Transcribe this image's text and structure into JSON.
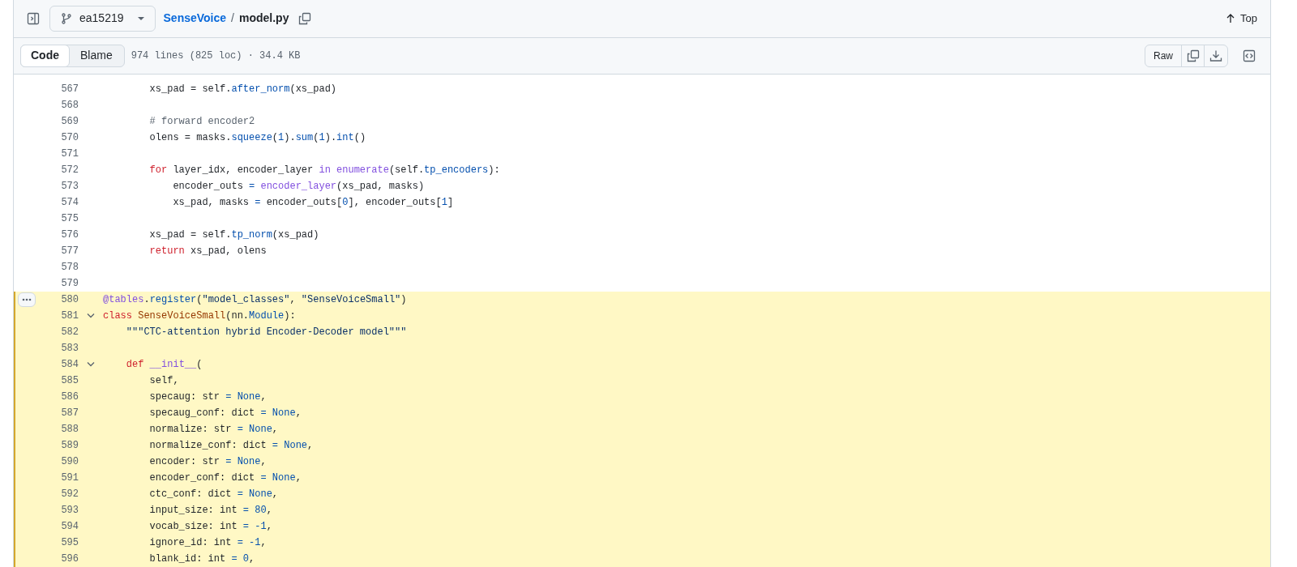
{
  "header": {
    "branch": "ea15219",
    "breadcrumb": {
      "repo": "SenseVoice",
      "separator": "/",
      "file": "model.py"
    },
    "top_label": "Top"
  },
  "toolbar": {
    "tabs": [
      {
        "label": "Code",
        "selected": true
      },
      {
        "label": "Blame",
        "selected": false
      }
    ],
    "file_info": "974 lines (825 loc) · 34.4 KB",
    "raw_label": "Raw"
  },
  "code_lines": [
    {
      "number": "567",
      "highlighted": false,
      "fold": false,
      "line_menu": false,
      "tokens": [
        {
          "text": "        xs_pad = self.",
          "kind": "plain"
        },
        {
          "text": "after_norm",
          "kind": "attr"
        },
        {
          "text": "(xs_pad)",
          "kind": "plain"
        }
      ]
    },
    {
      "number": "568",
      "highlighted": false,
      "fold": false,
      "line_menu": false
    },
    {
      "number": "569",
      "highlighted": false,
      "fold": false,
      "line_menu": false,
      "tokens": [
        {
          "text": "        # forward encoder2",
          "kind": "comment"
        }
      ]
    },
    {
      "number": "570",
      "highlighted": false,
      "fold": false,
      "line_menu": false,
      "tokens": [
        {
          "text": "        olens = masks.",
          "kind": "plain"
        },
        {
          "text": "squeeze",
          "kind": "attr"
        },
        {
          "text": "(",
          "kind": "plain"
        },
        {
          "text": "1",
          "kind": "attr"
        },
        {
          "text": ").",
          "kind": "plain"
        },
        {
          "text": "sum",
          "kind": "attr"
        },
        {
          "text": "(",
          "kind": "plain"
        },
        {
          "text": "1",
          "kind": "attr"
        },
        {
          "text": ").",
          "kind": "plain"
        },
        {
          "text": "int",
          "kind": "attr"
        },
        {
          "text": "()",
          "kind": "plain"
        }
      ]
    },
    {
      "number": "571",
      "highlighted": false,
      "fold": false,
      "line_menu": false
    },
    {
      "number": "572",
      "highlighted": false,
      "fold": false,
      "line_menu": false,
      "tokens": [
        {
          "text": "        for",
          "kind": "keyword"
        },
        {
          "text": " layer_idx, encoder_layer ",
          "kind": "plain"
        },
        {
          "text": "in enumerate",
          "kind": "call"
        },
        {
          "text": "(self.",
          "kind": "plain"
        },
        {
          "text": "tp_encoders",
          "kind": "attr"
        },
        {
          "text": "):",
          "kind": "plain"
        }
      ]
    },
    {
      "number": "573",
      "highlighted": false,
      "fold": false,
      "line_menu": false,
      "tokens": [
        {
          "text": "            encoder_outs ",
          "kind": "plain"
        },
        {
          "text": "=",
          "kind": "attr"
        },
        {
          "text": " encoder_layer",
          "kind": "call"
        },
        {
          "text": "(xs_pad, masks)",
          "kind": "plain"
        }
      ]
    },
    {
      "number": "574",
      "highlighted": false,
      "fold": false,
      "line_menu": false,
      "tokens": [
        {
          "text": "            xs_pad, masks ",
          "kind": "plain"
        },
        {
          "text": "=",
          "kind": "attr"
        },
        {
          "text": " encoder_outs[",
          "kind": "plain"
        },
        {
          "text": "0",
          "kind": "attr"
        },
        {
          "text": "], encoder_outs[",
          "kind": "plain"
        },
        {
          "text": "1",
          "kind": "attr"
        },
        {
          "text": "]",
          "kind": "plain"
        }
      ]
    },
    {
      "number": "575",
      "highlighted": false,
      "fold": false,
      "line_menu": false
    },
    {
      "number": "576",
      "highlighted": false,
      "fold": false,
      "line_menu": false,
      "tokens": [
        {
          "text": "        xs_pad = self.",
          "kind": "plain"
        },
        {
          "text": "tp_norm",
          "kind": "attr"
        },
        {
          "text": "(xs_pad)",
          "kind": "plain"
        }
      ]
    },
    {
      "number": "577",
      "highlighted": false,
      "fold": false,
      "line_menu": false,
      "tokens": [
        {
          "text": "        return",
          "kind": "keyword"
        },
        {
          "text": " xs_pad, olens",
          "kind": "plain"
        }
      ]
    },
    {
      "number": "578",
      "highlighted": false,
      "fold": false,
      "line_menu": false
    },
    {
      "number": "579",
      "highlighted": false,
      "fold": false,
      "line_menu": false
    },
    {
      "number": "580",
      "highlighted": true,
      "fold": false,
      "line_menu": true,
      "tokens": [
        {
          "text": "@tables",
          "kind": "call"
        },
        {
          "text": ".",
          "kind": "plain"
        },
        {
          "text": "register",
          "kind": "attr"
        },
        {
          "text": "(",
          "kind": "plain"
        },
        {
          "text": "\"model_classes\"",
          "kind": "string"
        },
        {
          "text": ",",
          "kind": "plain"
        },
        {
          "text": " \"SenseVoiceSmall\"",
          "kind": "string"
        },
        {
          "text": ")",
          "kind": "plain"
        }
      ]
    },
    {
      "number": "581",
      "highlighted": true,
      "fold": true,
      "line_menu": false,
      "tokens": [
        {
          "text": "class",
          "kind": "keyword"
        },
        {
          "text": " SenseVoiceSmall",
          "kind": "class"
        },
        {
          "text": "(nn.",
          "kind": "plain"
        },
        {
          "text": "Module",
          "kind": "attr"
        },
        {
          "text": "):",
          "kind": "plain"
        }
      ]
    },
    {
      "number": "582",
      "highlighted": true,
      "fold": false,
      "line_menu": false,
      "tokens": [
        {
          "text": "    \"\"\"CTC-attention hybrid Encoder-Decoder model\"\"\"",
          "kind": "string"
        }
      ]
    },
    {
      "number": "583",
      "highlighted": true,
      "fold": false,
      "line_menu": false
    },
    {
      "number": "584",
      "highlighted": true,
      "fold": true,
      "line_menu": false,
      "tokens": [
        {
          "text": "    def",
          "kind": "keyword"
        },
        {
          "text": " __init__",
          "kind": "call"
        },
        {
          "text": "(",
          "kind": "plain"
        }
      ]
    },
    {
      "number": "585",
      "highlighted": true,
      "fold": false,
      "line_menu": false,
      "tokens": [
        {
          "text": "        self,",
          "kind": "plain"
        }
      ]
    },
    {
      "number": "586",
      "highlighted": true,
      "fold": false,
      "line_menu": false,
      "tokens": [
        {
          "text": "        specaug: str ",
          "kind": "plain"
        },
        {
          "text": "= None",
          "kind": "attr"
        },
        {
          "text": ",",
          "kind": "plain"
        }
      ]
    },
    {
      "number": "587",
      "highlighted": true,
      "fold": false,
      "line_menu": false,
      "tokens": [
        {
          "text": "        specaug_conf: dict ",
          "kind": "plain"
        },
        {
          "text": "= None",
          "kind": "attr"
        },
        {
          "text": ",",
          "kind": "plain"
        }
      ]
    },
    {
      "number": "588",
      "highlighted": true,
      "fold": false,
      "line_menu": false,
      "tokens": [
        {
          "text": "        normalize: str ",
          "kind": "plain"
        },
        {
          "text": "= None",
          "kind": "attr"
        },
        {
          "text": ",",
          "kind": "plain"
        }
      ]
    },
    {
      "number": "589",
      "highlighted": true,
      "fold": false,
      "line_menu": false,
      "tokens": [
        {
          "text": "        normalize_conf: dict ",
          "kind": "plain"
        },
        {
          "text": "= None",
          "kind": "attr"
        },
        {
          "text": ",",
          "kind": "plain"
        }
      ]
    },
    {
      "number": "590",
      "highlighted": true,
      "fold": false,
      "line_menu": false,
      "tokens": [
        {
          "text": "        encoder: str ",
          "kind": "plain"
        },
        {
          "text": "= None",
          "kind": "attr"
        },
        {
          "text": ",",
          "kind": "plain"
        }
      ]
    },
    {
      "number": "591",
      "highlighted": true,
      "fold": false,
      "line_menu": false,
      "tokens": [
        {
          "text": "        encoder_conf: dict ",
          "kind": "plain"
        },
        {
          "text": "= None",
          "kind": "attr"
        },
        {
          "text": ",",
          "kind": "plain"
        }
      ]
    },
    {
      "number": "592",
      "highlighted": true,
      "fold": false,
      "line_menu": false,
      "tokens": [
        {
          "text": "        ctc_conf: dict ",
          "kind": "plain"
        },
        {
          "text": "= None",
          "kind": "attr"
        },
        {
          "text": ",",
          "kind": "plain"
        }
      ]
    },
    {
      "number": "593",
      "highlighted": true,
      "fold": false,
      "line_menu": false,
      "tokens": [
        {
          "text": "        input_size: int ",
          "kind": "plain"
        },
        {
          "text": "= 80",
          "kind": "attr"
        },
        {
          "text": ",",
          "kind": "plain"
        }
      ]
    },
    {
      "number": "594",
      "highlighted": true,
      "fold": false,
      "line_menu": false,
      "tokens": [
        {
          "text": "        vocab_size: int ",
          "kind": "plain"
        },
        {
          "text": "= -1",
          "kind": "attr"
        },
        {
          "text": ",",
          "kind": "plain"
        }
      ]
    },
    {
      "number": "595",
      "highlighted": true,
      "fold": false,
      "line_menu": false,
      "tokens": [
        {
          "text": "        ignore_id: int ",
          "kind": "plain"
        },
        {
          "text": "= -1",
          "kind": "attr"
        },
        {
          "text": ",",
          "kind": "plain"
        }
      ]
    },
    {
      "number": "596",
      "highlighted": true,
      "fold": false,
      "line_menu": false,
      "tokens": [
        {
          "text": "        blank_id: int ",
          "kind": "plain"
        },
        {
          "text": "= 0",
          "kind": "attr"
        },
        {
          "text": ",",
          "kind": "plain"
        }
      ]
    }
  ]
}
